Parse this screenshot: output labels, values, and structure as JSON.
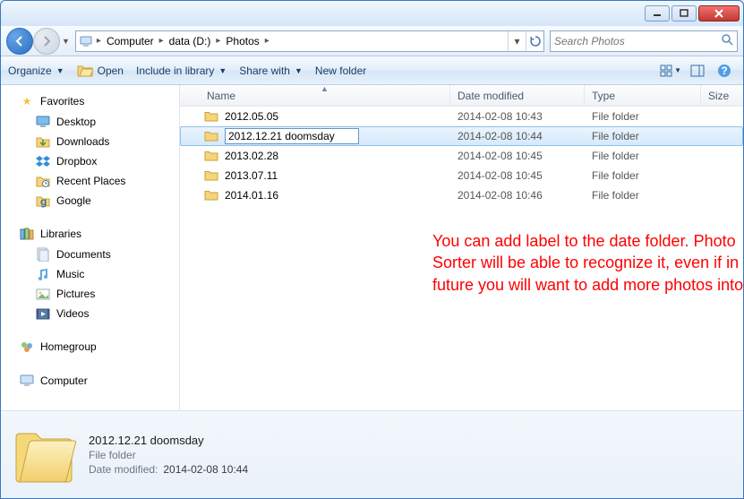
{
  "window": {
    "controls": {
      "min": "min",
      "max": "max",
      "close": "close"
    }
  },
  "nav": {
    "path": [
      "Computer",
      "data (D:)",
      "Photos"
    ],
    "search_placeholder": "Search Photos"
  },
  "toolbar": {
    "organize": "Organize",
    "open": "Open",
    "include": "Include in library",
    "share": "Share with",
    "newfolder": "New folder"
  },
  "sidebar": {
    "favorites": {
      "label": "Favorites",
      "items": [
        {
          "label": "Desktop",
          "icon": "desktop"
        },
        {
          "label": "Downloads",
          "icon": "downloads"
        },
        {
          "label": "Dropbox",
          "icon": "dropbox"
        },
        {
          "label": "Recent Places",
          "icon": "recent"
        },
        {
          "label": "Google",
          "icon": "google"
        }
      ]
    },
    "libraries": {
      "label": "Libraries",
      "items": [
        {
          "label": "Documents",
          "icon": "documents"
        },
        {
          "label": "Music",
          "icon": "music"
        },
        {
          "label": "Pictures",
          "icon": "pictures"
        },
        {
          "label": "Videos",
          "icon": "videos"
        }
      ]
    },
    "homegroup": {
      "label": "Homegroup"
    },
    "computer": {
      "label": "Computer"
    }
  },
  "columns": {
    "name": "Name",
    "date": "Date modified",
    "type": "Type",
    "size": "Size"
  },
  "rows": [
    {
      "name": "2012.05.05",
      "date": "2014-02-08 10:43",
      "type": "File folder",
      "selected": false,
      "editing": false
    },
    {
      "name": "2012.12.21 doomsday",
      "date": "2014-02-08 10:44",
      "type": "File folder",
      "selected": true,
      "editing": true
    },
    {
      "name": "2013.02.28",
      "date": "2014-02-08 10:45",
      "type": "File folder",
      "selected": false,
      "editing": false
    },
    {
      "name": "2013.07.11",
      "date": "2014-02-08 10:45",
      "type": "File folder",
      "selected": false,
      "editing": false
    },
    {
      "name": "2014.01.16",
      "date": "2014-02-08 10:46",
      "type": "File folder",
      "selected": false,
      "editing": false
    }
  ],
  "annotation": "You can add label to the date folder. Photo Sorter will be able to recognize it, even if in the future you will want to add more photos into it.",
  "details": {
    "title": "2012.12.21 doomsday",
    "type": "File folder",
    "date_label": "Date modified:",
    "date_value": "2014-02-08 10:44"
  }
}
